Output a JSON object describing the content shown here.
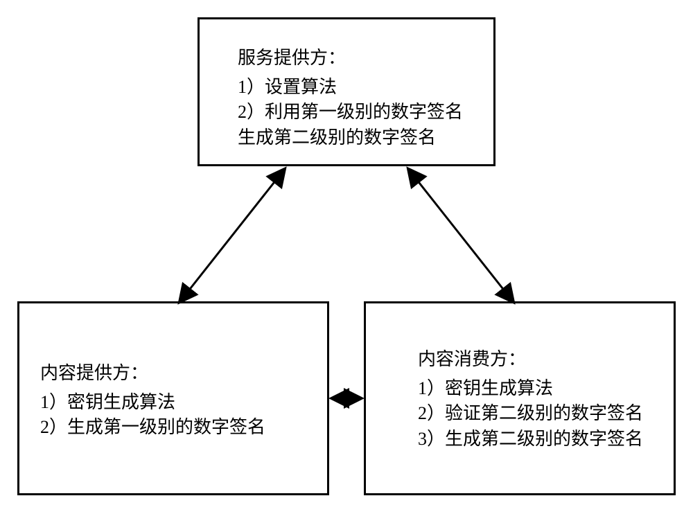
{
  "boxes": {
    "top": {
      "title": "服务提供方：",
      "item1": "1）设置算法",
      "item2": "2）利用第一级别的数字签名",
      "item3": "生成第二级别的数字签名"
    },
    "left": {
      "title": "内容提供方：",
      "item1": "1）密钥生成算法",
      "item2": "2）生成第一级别的数字签名"
    },
    "right": {
      "title": "内容消费方：",
      "item1": "1）密钥生成算法",
      "item2": "2）验证第二级别的数字签名",
      "item3": "3）生成第二级别的数字签名"
    }
  }
}
